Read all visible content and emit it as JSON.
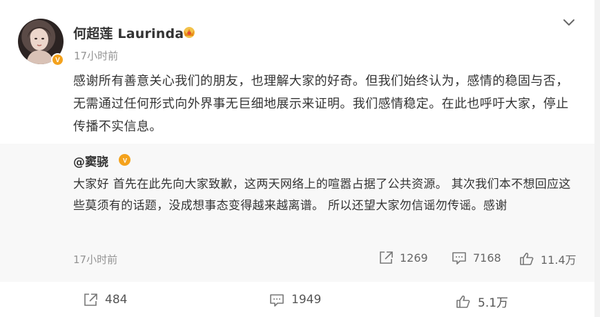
{
  "post": {
    "author": "何超莲 Laurinda",
    "time": "17小时前",
    "text": "感谢所有善意关心我们的朋友，也理解大家的好奇。但我们始终认为，感情的稳固与否，无需通过任何形式向外界事无巨细地展示来证明。我们感情稳定。在此也呼吁大家，停止传播不实信息。"
  },
  "repost": {
    "author": "@窦骁",
    "text": "大家好 首先在此先向大家致歉，这两天网络上的喧嚣占据了公共资源。 其次我们本不想回应这些莫须有的话题，没成想事态变得越来越离谱。 所以还望大家勿信谣勿传谣。感谢",
    "time": "17小时前",
    "forward_count": "1269",
    "comment_count": "7168",
    "like_count": "11.4万"
  },
  "footer": {
    "forward_count": "484",
    "comment_count": "1949",
    "like_count": "5.1万"
  },
  "icons": {
    "verified": "verified-badge-icon",
    "crown": "vip-crown-icon",
    "menu": "chevron-down-icon",
    "forward": "share-forward-icon",
    "comment": "comment-icon",
    "like": "thumbs-up-icon"
  },
  "colors": {
    "verified_badge": "#f4a21c",
    "secondary_text": "#939393",
    "repost_background": "#f8f8f8"
  }
}
